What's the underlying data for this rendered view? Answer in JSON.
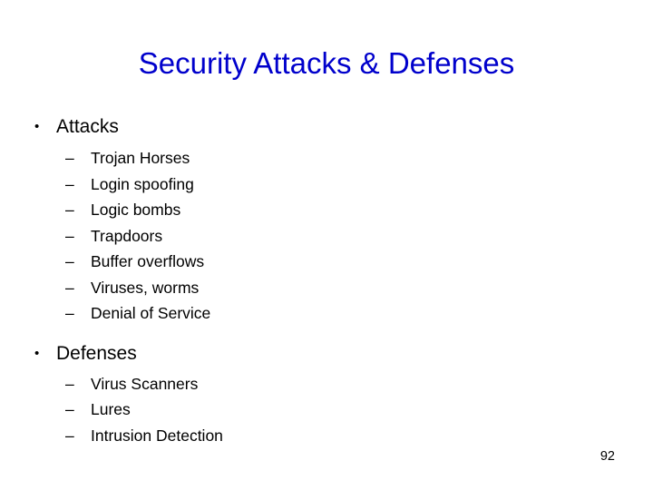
{
  "slide": {
    "title": "Security Attacks & Defenses",
    "title_color": "#0000cc",
    "background_color": "#ffffff",
    "page_number": "92",
    "bullet_glyph": "•",
    "dash_glyph": "–",
    "sections": [
      {
        "heading": "Attacks",
        "items": [
          "Trojan Horses",
          "Login spoofing",
          "Logic bombs",
          "Trapdoors",
          "Buffer overflows",
          "Viruses, worms",
          "Denial of Service"
        ]
      },
      {
        "heading": "Defenses",
        "items": [
          "Virus Scanners",
          "Lures",
          "Intrusion Detection"
        ]
      }
    ]
  }
}
